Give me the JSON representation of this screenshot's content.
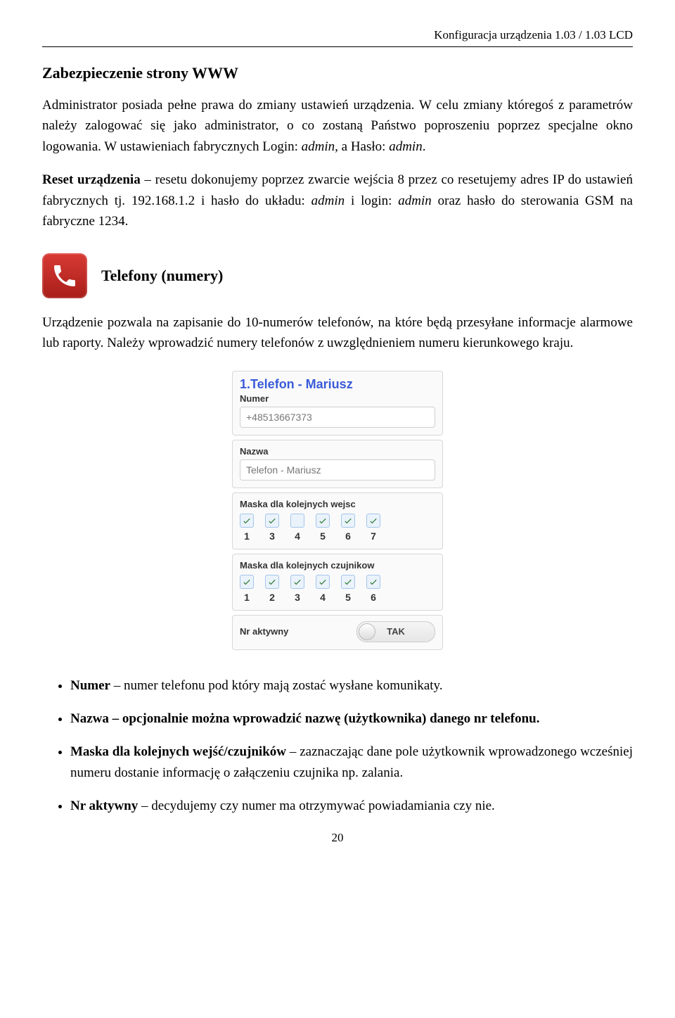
{
  "header": {
    "text": "Konfiguracja urządzenia 1.03 / 1.03 LCD"
  },
  "section1": {
    "title": "Zabezpieczenie strony WWW",
    "para1_pre": "Administrator posiada pełne prawa do zmiany ustawień urządzenia. W celu zmiany któregoś z parametrów należy zalogować się jako administrator, o co zostaną Państwo poproszeniu poprzez specjalne okno logowania. W ustawieniach fabrycznych Login: ",
    "login": "admin",
    "para1_mid": ", a Hasło: ",
    "haslo": "admin",
    "para1_post": "."
  },
  "section2": {
    "strong": "Reset urządzenia",
    "text_pre": " – resetu dokonujemy poprzez zwarcie wejścia 8 przez co resetujemy adres IP do ustawień fabrycznych tj. 192.168.1.2 i hasło do układu: ",
    "v1": "admin",
    "mid1": " i login: ",
    "v2": "admin",
    "text_post": " oraz hasło do sterowania GSM na fabryczne 1234."
  },
  "telefony": {
    "heading": "Telefony (numery)",
    "para": "Urządzenie pozwala na zapisanie do 10-numerów telefonów, na które będą przesyłane informacje alarmowe lub raporty. Należy wprowadzić numery telefonów z uwzględnieniem numeru kierunkowego kraju."
  },
  "phone_card": {
    "title": "1.Telefon - Mariusz",
    "numer_label": "Numer",
    "numer_value": "+48513667373",
    "nazwa_label": "Nazwa",
    "nazwa_value": "Telefon - Mariusz",
    "mask_wejsc_label": "Maska dla kolejnych wejsc",
    "wejsc": [
      {
        "n": "1",
        "on": true
      },
      {
        "n": "3",
        "on": true
      },
      {
        "n": "4",
        "on": false
      },
      {
        "n": "5",
        "on": true
      },
      {
        "n": "6",
        "on": true
      },
      {
        "n": "7",
        "on": true
      }
    ],
    "mask_czujnikow_label": "Maska dla kolejnych czujnikow",
    "czujnikow": [
      {
        "n": "1",
        "on": true
      },
      {
        "n": "2",
        "on": true
      },
      {
        "n": "3",
        "on": true
      },
      {
        "n": "4",
        "on": true
      },
      {
        "n": "5",
        "on": true
      },
      {
        "n": "6",
        "on": true
      }
    ],
    "aktywny_label": "Nr aktywny",
    "aktywny_value": "TAK"
  },
  "bullets": {
    "b1_strong": "Numer",
    "b1_rest": " – numer telefonu pod który mają zostać wysłane komunikaty.",
    "b2_strong": "Nazwa",
    "b2_rest": " – opcjonalnie można wprowadzić nazwę (użytkownika) danego nr telefonu.",
    "b3_strong": "Maska dla kolejnych wejść/czujników",
    "b3_rest": " – zaznaczając dane pole użytkownik wprowadzonego wcześniej numeru dostanie informację o załączeniu czujnika np. zalania.",
    "b4_strong": "Nr aktywny",
    "b4_rest": " – decydujemy czy numer ma otrzymywać powiadamiania czy nie."
  },
  "page_number": "20"
}
